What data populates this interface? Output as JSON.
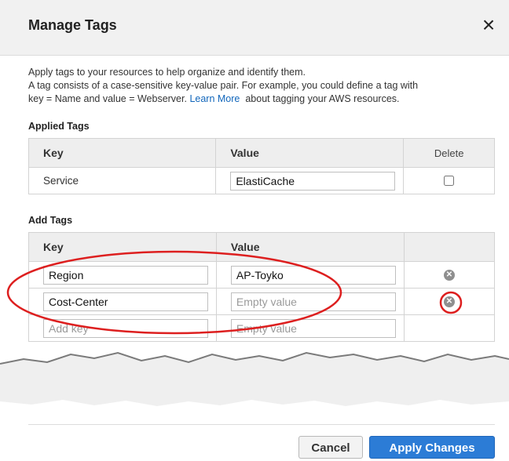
{
  "dialog": {
    "title": "Manage Tags",
    "close_symbol": "×",
    "intro_line1": "Apply tags to your resources to help organize and identify them.",
    "intro_line2": "A tag consists of a case-sensitive key-value pair. For example, you could define a tag with",
    "intro_line3_pre": "key = Name and value = Webserver.",
    "learn_more": "Learn More",
    "intro_line3_post": "about tagging your AWS resources."
  },
  "applied": {
    "label": "Applied Tags",
    "headers": {
      "key": "Key",
      "value": "Value",
      "delete": "Delete"
    },
    "rows": [
      {
        "key": "Service",
        "value": "ElastiCache",
        "delete_checked": false
      }
    ]
  },
  "add": {
    "label": "Add Tags",
    "headers": {
      "key": "Key",
      "value": "Value"
    },
    "rows": [
      {
        "key": "Region",
        "value": "AP-Toyko",
        "value_placeholder": "Empty value"
      },
      {
        "key": "Cost-Center",
        "value": "",
        "value_placeholder": "Empty value"
      }
    ],
    "new_row": {
      "key_placeholder": "Add key",
      "value_placeholder": "Empty value"
    }
  },
  "footer": {
    "cancel_label": "Cancel",
    "apply_label": "Apply Changes"
  },
  "icons": {
    "close": "close-icon",
    "remove": "remove-circle-icon"
  },
  "colors": {
    "accent": "#2c7cd6",
    "annotation": "#dd1f1f",
    "header_bg": "#f1f1f1"
  }
}
